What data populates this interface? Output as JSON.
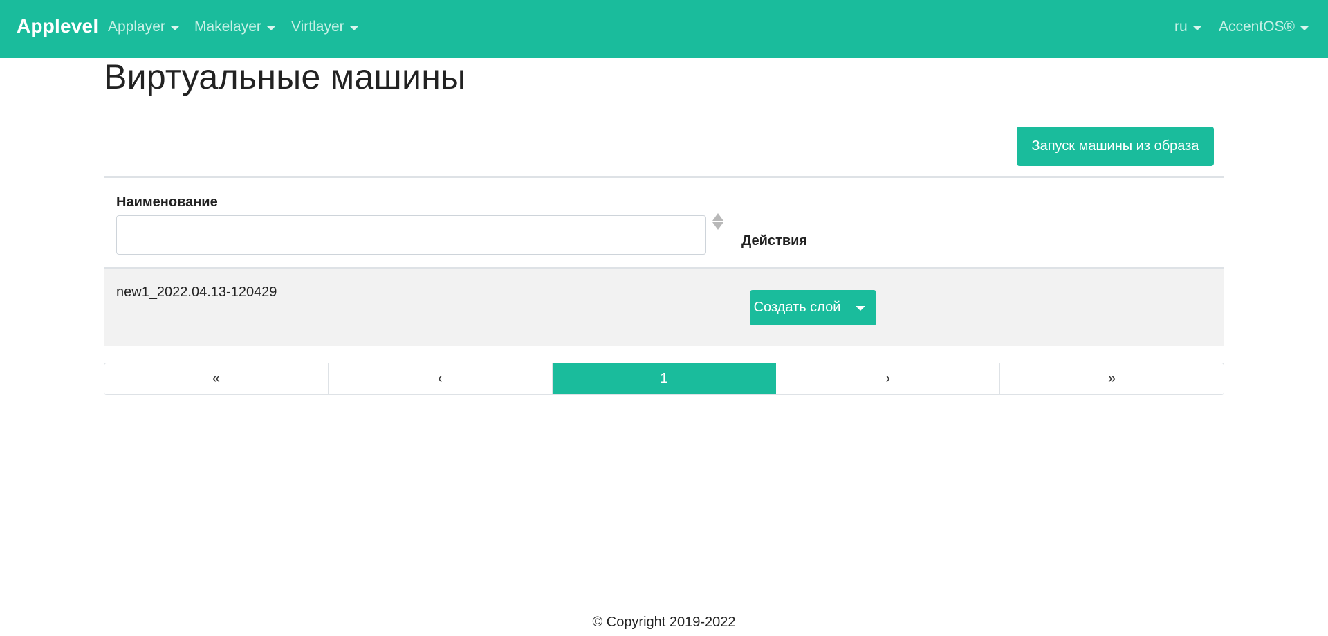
{
  "navbar": {
    "brand": "Applevel",
    "menus": [
      {
        "label": "Applayer"
      },
      {
        "label": "Makelayer"
      },
      {
        "label": "Virtlayer"
      }
    ],
    "language": "ru",
    "account": "AccentOS®",
    "color": "#1abc9c"
  },
  "page": {
    "title": "Виртуальные машины",
    "launch_button": "Запуск машины из образа"
  },
  "table": {
    "columns": {
      "name": "Наименование",
      "actions": "Действия"
    },
    "filter": {
      "value": "",
      "placeholder": ""
    },
    "rows": [
      {
        "name": "new1_2022.04.13-120429",
        "action_label": "Создать слой"
      }
    ]
  },
  "pagination": {
    "first": "«",
    "prev": "‹",
    "current": "1",
    "next": "›",
    "last": "»"
  },
  "footer": {
    "copyright": "© Copyright 2019-2022"
  },
  "icons": {
    "menu_caret": "chevron-down-icon",
    "sort": "sort-icon",
    "split_caret": "chevron-down-icon"
  }
}
